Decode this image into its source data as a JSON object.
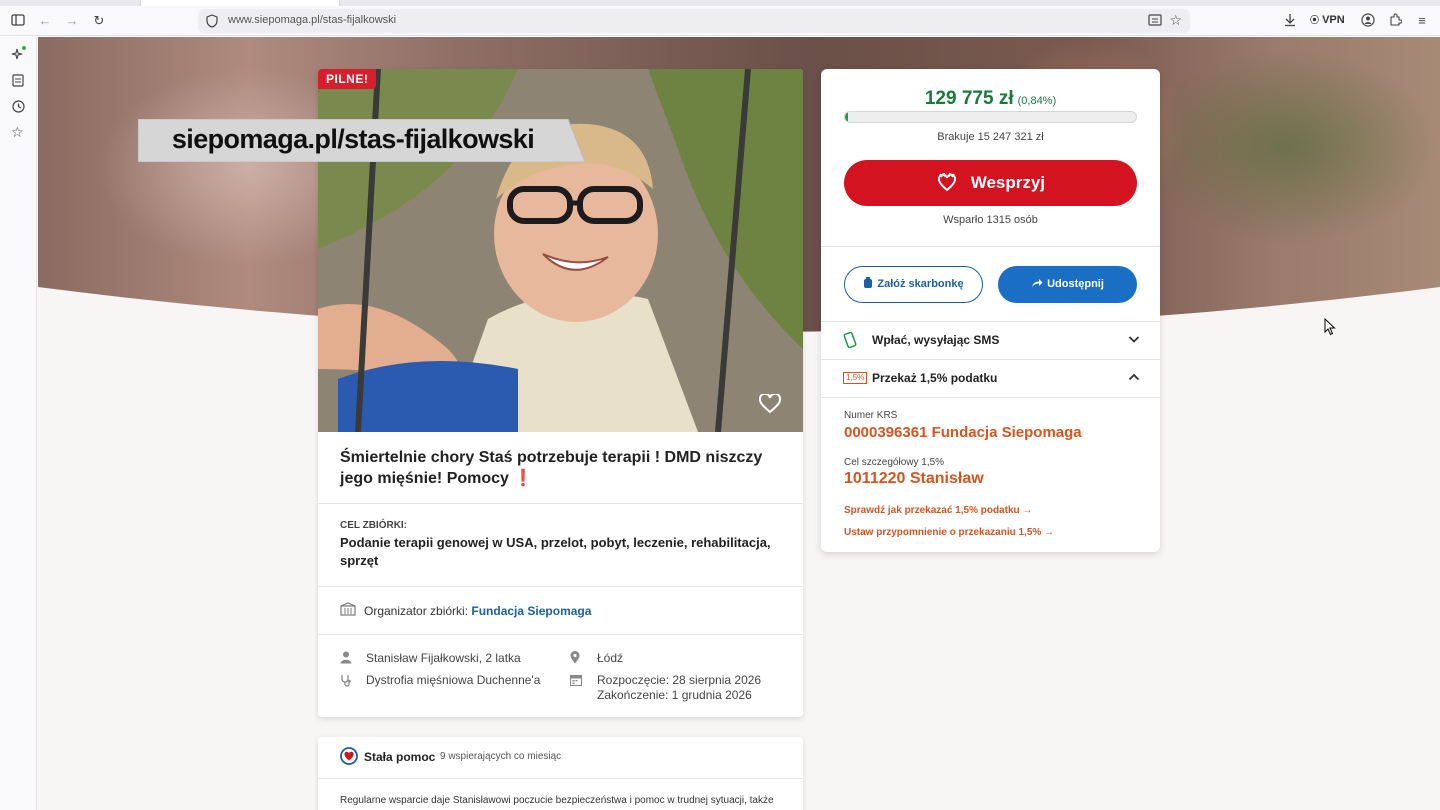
{
  "browser": {
    "url": "www.siepomaga.pl/stas-fijalkowski",
    "vpn_label": "VPN"
  },
  "campaign": {
    "urgent_badge": "PILNE!",
    "photo_overlay_text": "siepomaga.pl/stas-fijalkowski",
    "title": "Śmiertelnie chory Staś potrzebuje terapii ! DMD niszczy jego mięśnie! Pomocy",
    "title_mark": "❗",
    "goal_label": "CEL ZBIÓRKI:",
    "goal_text": "Podanie terapii genowej w USA, przelot, pobyt, leczenie, rehabilitacja, sprzęt",
    "organizer_label": "Organizator zbiórki:",
    "organizer_name": "Fundacja Siepomaga",
    "beneficiary": "Stanisław Fijałkowski, 2 latka",
    "diagnosis": "Dystrofia mięśniowa Duchenne'a",
    "location": "Łódź",
    "start_date": "Rozpoczęcie: 28 sierpnia 2026",
    "end_date": "Zakończenie: 1 grudnia 2026"
  },
  "constant_help": {
    "title": "Stała pomoc",
    "subtitle": "9 wspierających co miesiąc",
    "text": "Regularne wsparcie daje Stanisławowi poczucie bezpieczeństwa i pomoc w trudnej sytuacji, także"
  },
  "donation": {
    "amount": "129 775 zł",
    "percent": "(0,84%)",
    "progress_fraction": 0.0084,
    "missing": "Brakuje 15 247 321 zł",
    "support_button": "Wesprzyj",
    "supported_count": "Wsparło 1315 osób",
    "piggybank_button": "Załóż skarbonkę",
    "share_button": "Udostępnij",
    "sms_label": "Wpłać, wysyłając SMS",
    "tax_label": "Przekaż 1,5% podatku",
    "tax_badge": "1,5%",
    "krs_label": "Numer KRS",
    "krs_value": "0000396361 Fundacja Siepomaga",
    "goal_code_label": "Cel szczegółowy 1,5%",
    "goal_code_value": "1011220 Stanisław",
    "check_link": "Sprawdź jak przekazać 1,5% podatku →",
    "reminder_link": "Ustaw przypomnienie o przekazaniu 1,5% →"
  },
  "colors": {
    "brand_red": "#d3131f",
    "accent_orange": "#d9531e",
    "success_green": "#1a7a3a",
    "link_blue": "#1a5fa8"
  }
}
